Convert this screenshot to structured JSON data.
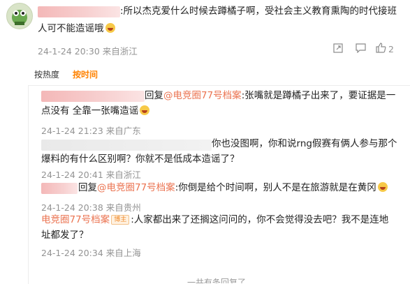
{
  "comment": {
    "text_line1": ":所以杰克爱什么时候去蹲橘子啊，受社会主义教育熏陶的时代接班",
    "text_line2": "人可不能造谣哦",
    "meta": "24-1-24 20:30 来自浙江",
    "like_count": "2",
    "icons": [
      "share-icon",
      "comment-icon",
      "like-icon"
    ]
  },
  "tabs": {
    "by_hot": "按热度",
    "by_time": "按时间"
  },
  "replies": [
    {
      "reply_word": "回复",
      "mention": "@电竞圈77号档案",
      "text_line1": ":张嘴就是蹲橘子出来了，要证据是一",
      "text_line2": "点没有 全靠一张嘴造谣",
      "meta": "24-1-24 21:23 来自广东"
    },
    {
      "text_line1": "你也没图啊，你和说rng假赛有俩人参与那个",
      "text_line2": "爆料的有什么区别啊？你就不是低成本造谣了？",
      "meta": "24-1-24 20:41 来自浙江"
    },
    {
      "reply_word": "回复",
      "mention": "@电竞圈77号档案",
      "text_line1": ":你倒是给个时间啊，别人不是在旅游就是在黄冈",
      "meta": "24-1-24 20:38 来自贵州"
    },
    {
      "author": "电竞圈77号档案",
      "badge": "博主",
      "text_line1": ":人家都出来了还搁这问问的，你不会觉得没去吧？我不是连地",
      "text_line2": "址都发了？",
      "meta": "24-1-24 20:34 来自上海"
    }
  ],
  "footer_partial": "一共有条回复了"
}
